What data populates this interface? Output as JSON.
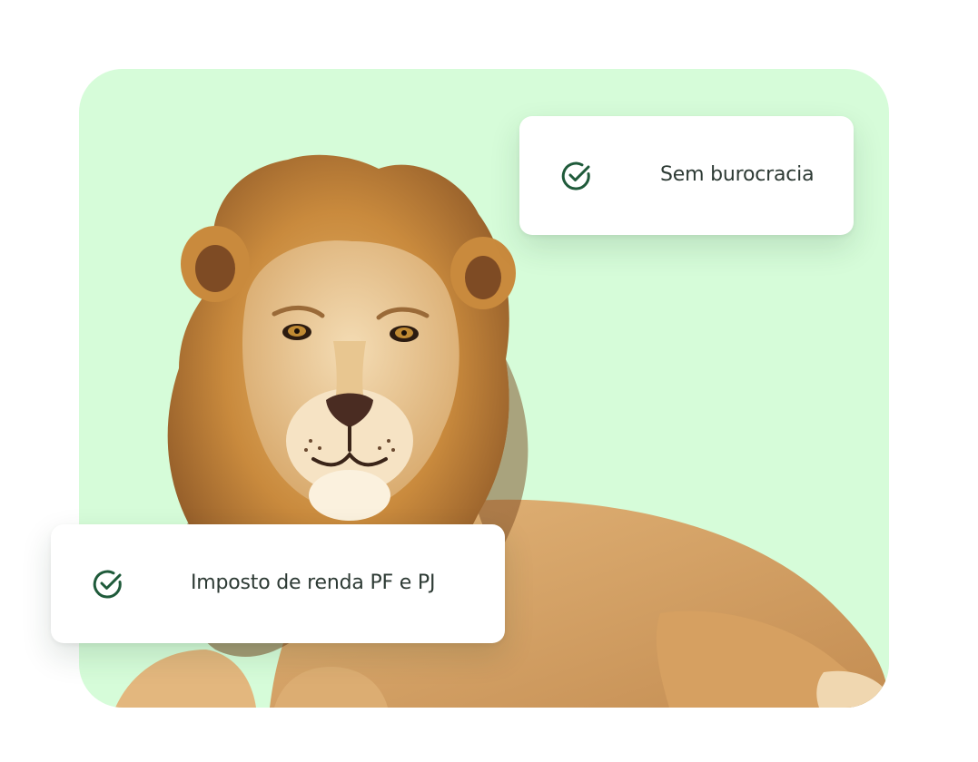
{
  "colors": {
    "panel_background": "#d6fcd9",
    "card_background": "#ffffff",
    "check_color": "#1f5a3a",
    "label_color": "#2d3a34"
  },
  "illustration": {
    "subject": "lion",
    "icon": "lion-illustration"
  },
  "features": [
    {
      "icon": "check-circle-icon",
      "label": "Sem burocracia"
    },
    {
      "icon": "check-circle-icon",
      "label": "Imposto de renda PF e PJ"
    }
  ]
}
